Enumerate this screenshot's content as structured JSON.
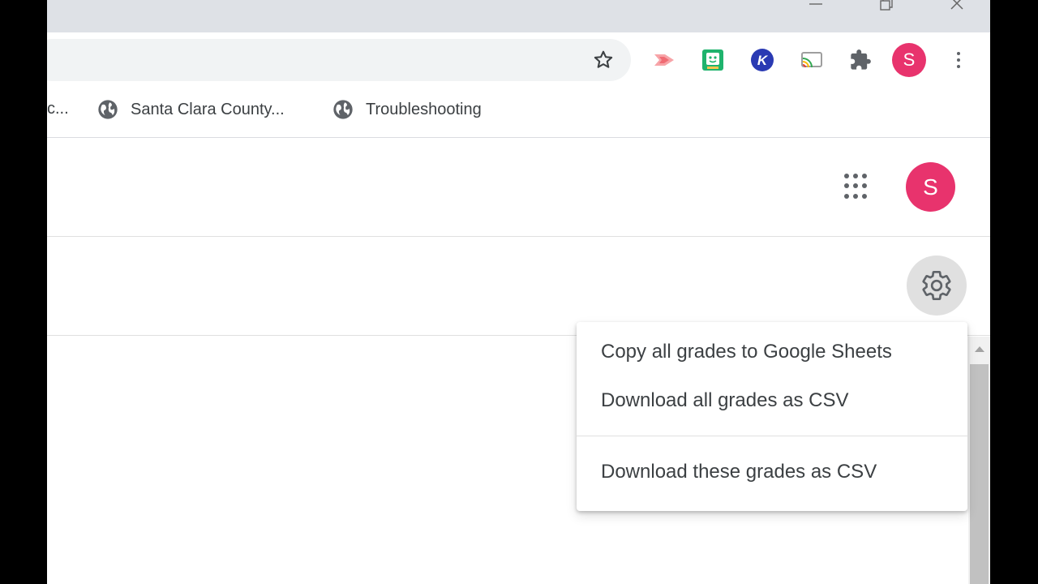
{
  "window": {
    "controls": {
      "minimize": "─",
      "maximize": "❐",
      "close": "✕"
    }
  },
  "toolbar": {
    "star_icon": "star-outline-icon",
    "extensions": [
      {
        "icon": "screencastify-icon",
        "color": "#f06b73"
      },
      {
        "icon": "pear-deck-icon",
        "color": "#1fb36d"
      },
      {
        "icon": "kami-icon",
        "color": "#2a3ab3",
        "glyph": "K"
      },
      {
        "icon": "cast-icon",
        "color": "#9e9e9e"
      },
      {
        "icon": "puzzle-icon",
        "color": "#5f6368"
      }
    ],
    "profile_initial": "S",
    "menu_icon": "kebab-menu-icon"
  },
  "bookmarks": {
    "truncated": "c...",
    "items": [
      {
        "label": "Santa Clara County...",
        "icon": "globe-icon"
      },
      {
        "label": "Troubleshooting",
        "icon": "globe-icon"
      }
    ]
  },
  "app": {
    "account_initial": "S",
    "accent_color": "#e8336d"
  },
  "settings_menu": {
    "items": [
      {
        "label": "Copy all grades to Google Sheets"
      },
      {
        "label": "Download all grades as CSV"
      },
      {
        "label": "Download these grades as CSV"
      }
    ]
  }
}
